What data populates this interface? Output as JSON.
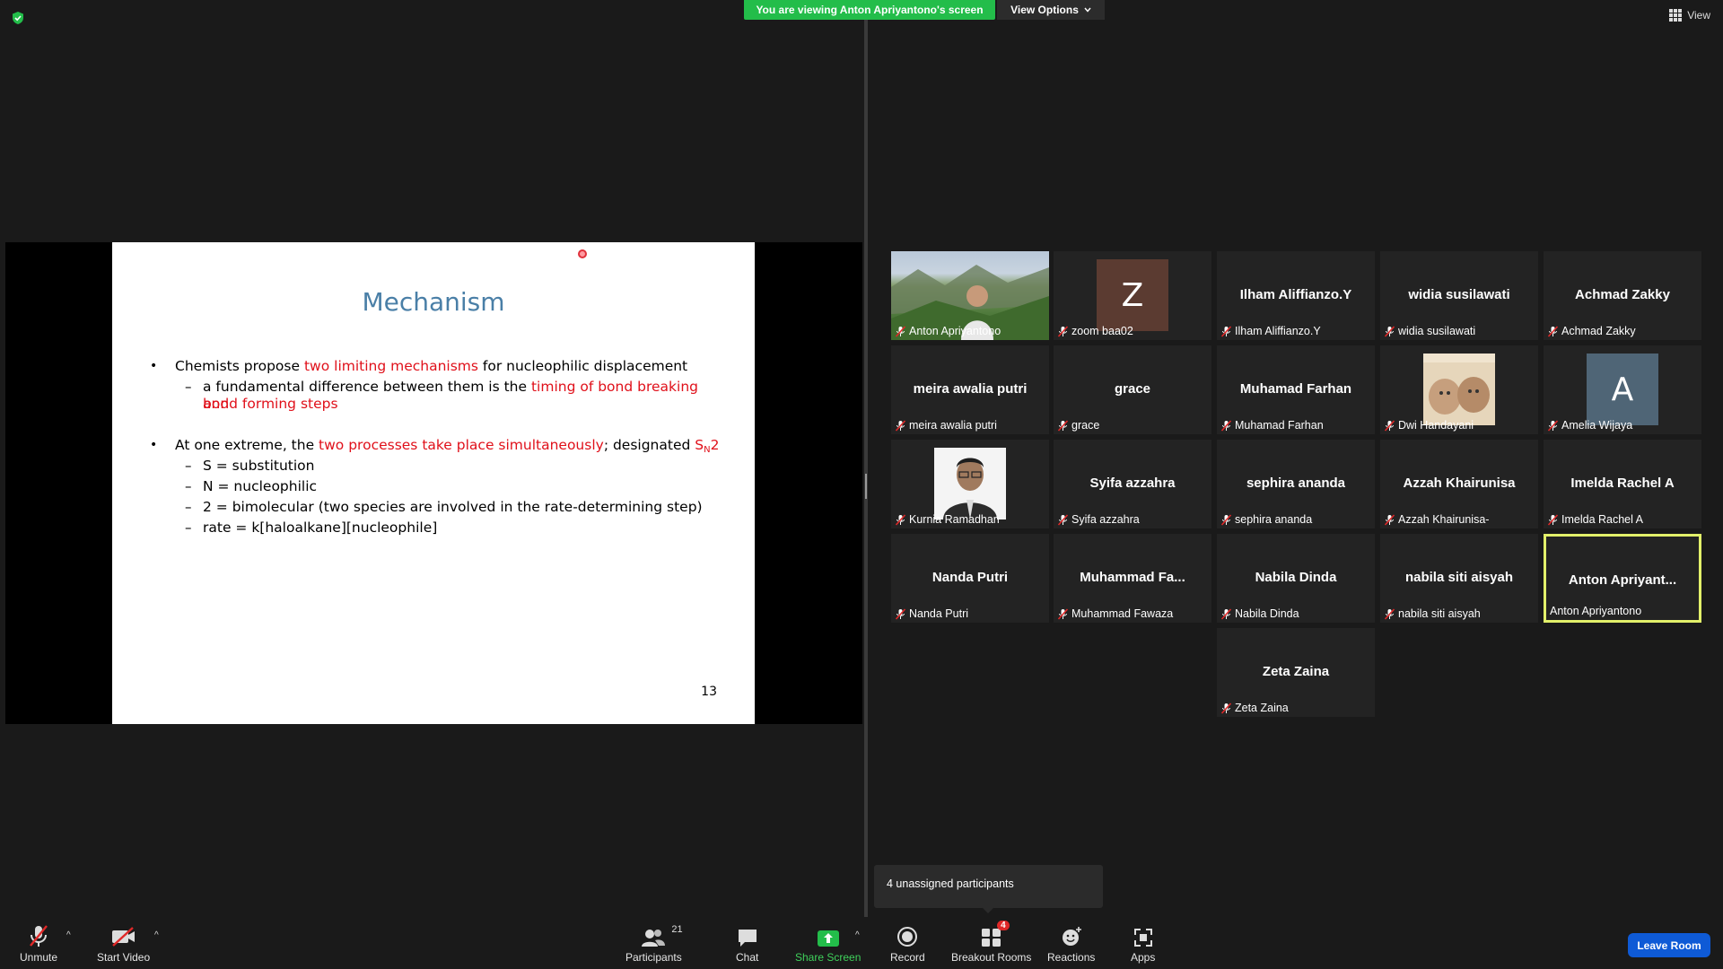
{
  "banner": {
    "viewing": "You are viewing Anton Apriyantono's screen",
    "view_options": "View Options",
    "view": "View"
  },
  "slide": {
    "title": "Mechanism",
    "b1_pre": "Chemists propose ",
    "b1_red": "two limiting mechanisms",
    "b1_post": " for nucleophilic displacement",
    "s1_pre": "a fundamental difference between them is the ",
    "s1_red_a": "timing of bond breaking and",
    "s1_red_b": "bond forming steps",
    "b2_pre": "At one extreme, the ",
    "b2_red": "two processes take place simultaneously",
    "b2_post": "; designated ",
    "b2_sn": "S",
    "b2_sub": "N",
    "b2_two": "2",
    "s2_1": "S = substitution",
    "s2_2": "N = nucleophilic",
    "s2_3": "2 = bimolecular (two species are involved in the rate-determining step)",
    "s2_4": "rate = k[haloalkane][nucleophile]",
    "page": "13",
    "dash": "–",
    "bullet": "•"
  },
  "tiles": [
    {
      "name": "",
      "label": "Anton Apriyantono",
      "kind": "video"
    },
    {
      "name": "",
      "label": "zoom baa02",
      "avatar": "Z",
      "avatar_color": "#5b3b31"
    },
    {
      "name": "Ilham Aliffianzo.Y",
      "label": "Ilham Aliffianzo.Y"
    },
    {
      "name": "widia susilawati",
      "label": "widia susilawati"
    },
    {
      "name": "Achmad Zakky",
      "label": "Achmad Zakky"
    },
    {
      "name": "meira awalia putri",
      "label": "meira awalia putri"
    },
    {
      "name": "grace",
      "label": "grace"
    },
    {
      "name": "Muhamad Farhan",
      "label": "Muhamad Farhan"
    },
    {
      "name": "",
      "label": "Dwi Handayani",
      "kind": "photo-cats"
    },
    {
      "name": "",
      "label": "Amelia Wijaya",
      "avatar": "A",
      "avatar_color": "#4f6576"
    },
    {
      "name": "",
      "label": "Kurnia Ramadhan",
      "kind": "photo-person"
    },
    {
      "name": "Syifa azzahra",
      "label": "Syifa azzahra"
    },
    {
      "name": "sephira ananda",
      "label": "sephira ananda"
    },
    {
      "name": "Azzah Khairunisa",
      "label": "Azzah Khairunisa-"
    },
    {
      "name": "Imelda Rachel A",
      "label": "Imelda Rachel A"
    },
    {
      "name": "Nanda Putri",
      "label": "Nanda Putri"
    },
    {
      "name": "Muhammad  Fa...",
      "label": "Muhammad Fawaza"
    },
    {
      "name": "Nabila Dinda",
      "label": "Nabila Dinda"
    },
    {
      "name": "nabila siti aisyah",
      "label": "nabila siti aisyah"
    },
    {
      "name": "Anton  Apriyant...",
      "label": "Anton Apriyantono",
      "active": true
    },
    {
      "name": "Zeta Zaina",
      "label": "Zeta Zaina"
    }
  ],
  "unassigned": "4 unassigned participants",
  "toolbar": {
    "unmute": "Unmute",
    "start_video": "Start Video",
    "participants": "Participants",
    "participants_count": "21",
    "chat": "Chat",
    "share_screen": "Share Screen",
    "record": "Record",
    "breakout_rooms": "Breakout Rooms",
    "breakout_badge": "4",
    "reactions": "Reactions",
    "apps": "Apps",
    "leave": "Leave Room",
    "caret": "^"
  },
  "colors": {
    "banner_green": "#23bd4a",
    "active_border": "#e2f06a",
    "leave_blue": "#0e5ad6",
    "slide_title": "#4a7fa7",
    "slide_red": "#e0101a"
  }
}
